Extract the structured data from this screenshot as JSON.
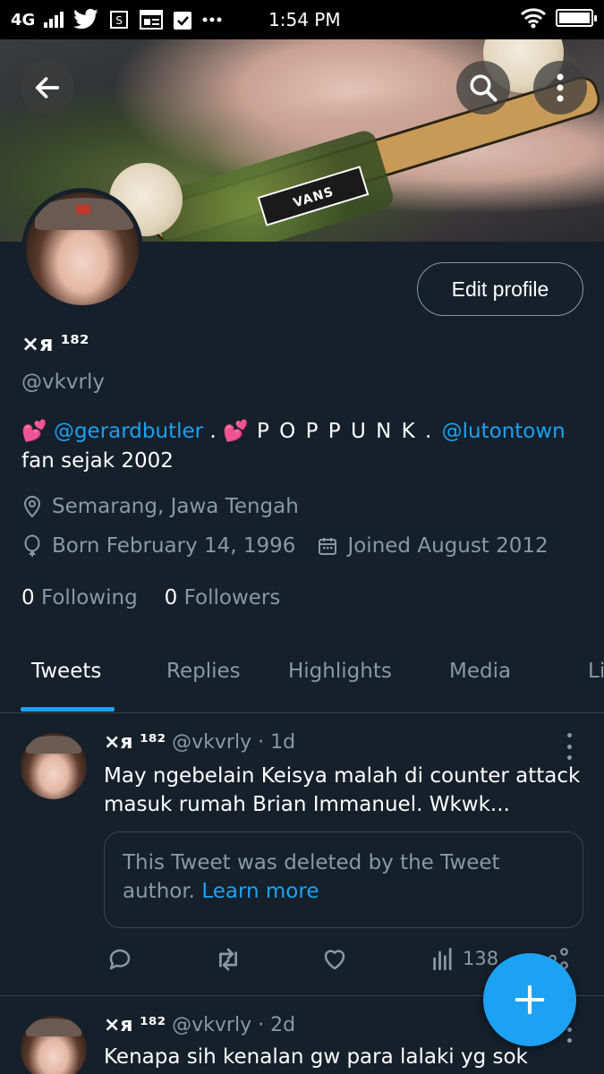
{
  "status_bar": {
    "network": "4G",
    "time": "1:54 PM",
    "battery_level": 1.0,
    "notification_icons": [
      "twitter-icon",
      "shop-icon",
      "news-icon",
      "calendar-check-icon",
      "more-dots-icon"
    ]
  },
  "header": {
    "back_icon": "arrow-left-icon",
    "search_icon": "search-icon",
    "more_icon": "more-vertical-icon",
    "banner_text": "VANS"
  },
  "profile": {
    "edit_label": "Edit profile",
    "name": "×я ¹⁸²",
    "handle": "@vkvrly",
    "bio": {
      "heart1": "💕",
      "mention1": "@gerardbutler",
      "sep1": " . ",
      "heart2": "💕",
      "text1": " P O P P U N K . ",
      "mention2": "@lutontown",
      "line2": "fan sejak 2002"
    },
    "location": "Semarang, Jawa Tengah",
    "birthday": "Born February 14, 1996",
    "joined": "Joined August 2012",
    "following_count": "0",
    "following_label": "Following",
    "followers_count": "0",
    "followers_label": "Followers"
  },
  "tabs": [
    {
      "label": "Tweets",
      "active": true
    },
    {
      "label": "Replies",
      "active": false
    },
    {
      "label": "Highlights",
      "active": false
    },
    {
      "label": "Media",
      "active": false
    },
    {
      "label": "Li",
      "active": false
    }
  ],
  "tweets": [
    {
      "name": "×я ¹⁸²",
      "handle_time": "@vkvrly · 1d",
      "text": "May ngebelain Keisya malah di counter attack masuk rumah Brian Immanuel. Wkwk...",
      "quote_text": "This Tweet was deleted by the Tweet author. ",
      "quote_link": "Learn more",
      "views": "138"
    },
    {
      "name": "×я ¹⁸²",
      "handle_time": "@vkvrly · 2d",
      "text": "Kenapa sih kenalan gw para lalaki yg sok"
    }
  ],
  "colors": {
    "background": "#15202b",
    "accent": "#1da1f2",
    "secondary_text": "#8899a6",
    "border": "#38444d"
  }
}
